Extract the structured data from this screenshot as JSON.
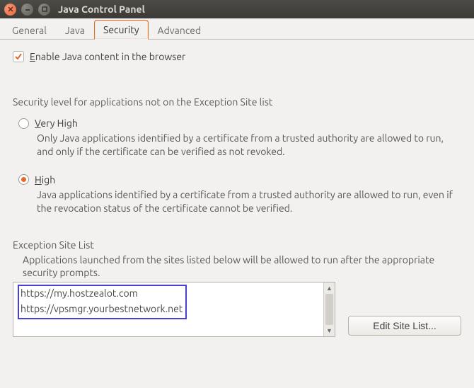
{
  "window": {
    "title": "Java Control Panel"
  },
  "tabs": {
    "general": "General",
    "java": "Java",
    "security": "Security",
    "advanced": "Advanced"
  },
  "enable": {
    "prefix": "E",
    "rest": "nable Java content in the browser"
  },
  "securityLevel": {
    "heading": "Security level for applications not on the Exception Site list",
    "veryHigh": {
      "prefix": "V",
      "rest": "ery High",
      "desc": "Only Java applications identified by a certificate from a trusted authority are allowed to run, and only if the certificate can be verified as not revoked."
    },
    "high": {
      "prefix": "H",
      "rest": "igh",
      "desc": "Java applications identified by a certificate from a trusted authority are allowed to run, even if the revocation status of the certificate cannot be verified."
    }
  },
  "exception": {
    "heading": "Exception Site List",
    "desc": "Applications launched from the sites listed below will be allowed to run after the appropriate security prompts.",
    "items": [
      "https://my.hostzealot.com",
      "https://vpsmgr.yourbestnetwork.net"
    ],
    "editButton": "Edit Site List..."
  }
}
